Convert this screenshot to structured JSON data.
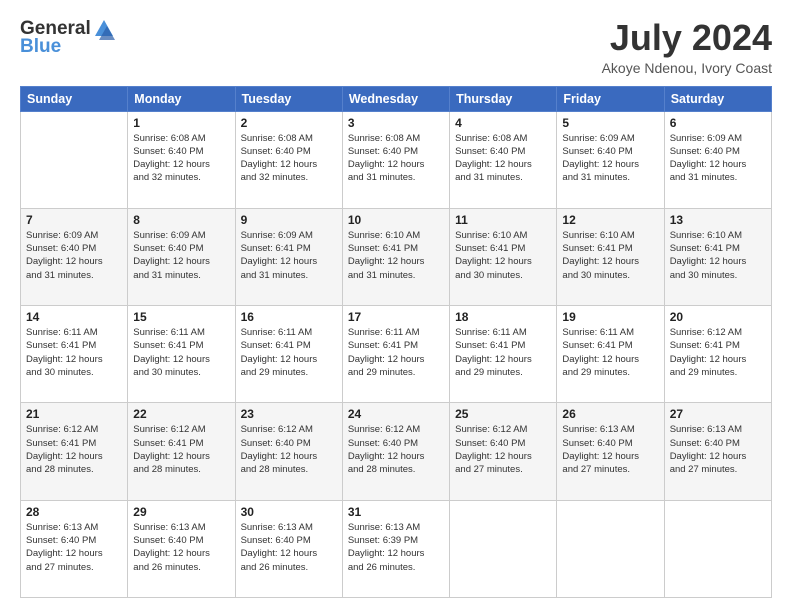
{
  "logo": {
    "general": "General",
    "blue": "Blue"
  },
  "header": {
    "month": "July 2024",
    "location": "Akoye Ndenou, Ivory Coast"
  },
  "weekdays": [
    "Sunday",
    "Monday",
    "Tuesday",
    "Wednesday",
    "Thursday",
    "Friday",
    "Saturday"
  ],
  "weeks": [
    [
      {
        "day": "",
        "info": ""
      },
      {
        "day": "1",
        "info": "Sunrise: 6:08 AM\nSunset: 6:40 PM\nDaylight: 12 hours\nand 32 minutes."
      },
      {
        "day": "2",
        "info": "Sunrise: 6:08 AM\nSunset: 6:40 PM\nDaylight: 12 hours\nand 32 minutes."
      },
      {
        "day": "3",
        "info": "Sunrise: 6:08 AM\nSunset: 6:40 PM\nDaylight: 12 hours\nand 31 minutes."
      },
      {
        "day": "4",
        "info": "Sunrise: 6:08 AM\nSunset: 6:40 PM\nDaylight: 12 hours\nand 31 minutes."
      },
      {
        "day": "5",
        "info": "Sunrise: 6:09 AM\nSunset: 6:40 PM\nDaylight: 12 hours\nand 31 minutes."
      },
      {
        "day": "6",
        "info": "Sunrise: 6:09 AM\nSunset: 6:40 PM\nDaylight: 12 hours\nand 31 minutes."
      }
    ],
    [
      {
        "day": "7",
        "info": "Sunrise: 6:09 AM\nSunset: 6:40 PM\nDaylight: 12 hours\nand 31 minutes."
      },
      {
        "day": "8",
        "info": "Sunrise: 6:09 AM\nSunset: 6:40 PM\nDaylight: 12 hours\nand 31 minutes."
      },
      {
        "day": "9",
        "info": "Sunrise: 6:09 AM\nSunset: 6:41 PM\nDaylight: 12 hours\nand 31 minutes."
      },
      {
        "day": "10",
        "info": "Sunrise: 6:10 AM\nSunset: 6:41 PM\nDaylight: 12 hours\nand 31 minutes."
      },
      {
        "day": "11",
        "info": "Sunrise: 6:10 AM\nSunset: 6:41 PM\nDaylight: 12 hours\nand 30 minutes."
      },
      {
        "day": "12",
        "info": "Sunrise: 6:10 AM\nSunset: 6:41 PM\nDaylight: 12 hours\nand 30 minutes."
      },
      {
        "day": "13",
        "info": "Sunrise: 6:10 AM\nSunset: 6:41 PM\nDaylight: 12 hours\nand 30 minutes."
      }
    ],
    [
      {
        "day": "14",
        "info": "Sunrise: 6:11 AM\nSunset: 6:41 PM\nDaylight: 12 hours\nand 30 minutes."
      },
      {
        "day": "15",
        "info": "Sunrise: 6:11 AM\nSunset: 6:41 PM\nDaylight: 12 hours\nand 30 minutes."
      },
      {
        "day": "16",
        "info": "Sunrise: 6:11 AM\nSunset: 6:41 PM\nDaylight: 12 hours\nand 29 minutes."
      },
      {
        "day": "17",
        "info": "Sunrise: 6:11 AM\nSunset: 6:41 PM\nDaylight: 12 hours\nand 29 minutes."
      },
      {
        "day": "18",
        "info": "Sunrise: 6:11 AM\nSunset: 6:41 PM\nDaylight: 12 hours\nand 29 minutes."
      },
      {
        "day": "19",
        "info": "Sunrise: 6:11 AM\nSunset: 6:41 PM\nDaylight: 12 hours\nand 29 minutes."
      },
      {
        "day": "20",
        "info": "Sunrise: 6:12 AM\nSunset: 6:41 PM\nDaylight: 12 hours\nand 29 minutes."
      }
    ],
    [
      {
        "day": "21",
        "info": "Sunrise: 6:12 AM\nSunset: 6:41 PM\nDaylight: 12 hours\nand 28 minutes."
      },
      {
        "day": "22",
        "info": "Sunrise: 6:12 AM\nSunset: 6:41 PM\nDaylight: 12 hours\nand 28 minutes."
      },
      {
        "day": "23",
        "info": "Sunrise: 6:12 AM\nSunset: 6:40 PM\nDaylight: 12 hours\nand 28 minutes."
      },
      {
        "day": "24",
        "info": "Sunrise: 6:12 AM\nSunset: 6:40 PM\nDaylight: 12 hours\nand 28 minutes."
      },
      {
        "day": "25",
        "info": "Sunrise: 6:12 AM\nSunset: 6:40 PM\nDaylight: 12 hours\nand 27 minutes."
      },
      {
        "day": "26",
        "info": "Sunrise: 6:13 AM\nSunset: 6:40 PM\nDaylight: 12 hours\nand 27 minutes."
      },
      {
        "day": "27",
        "info": "Sunrise: 6:13 AM\nSunset: 6:40 PM\nDaylight: 12 hours\nand 27 minutes."
      }
    ],
    [
      {
        "day": "28",
        "info": "Sunrise: 6:13 AM\nSunset: 6:40 PM\nDaylight: 12 hours\nand 27 minutes."
      },
      {
        "day": "29",
        "info": "Sunrise: 6:13 AM\nSunset: 6:40 PM\nDaylight: 12 hours\nand 26 minutes."
      },
      {
        "day": "30",
        "info": "Sunrise: 6:13 AM\nSunset: 6:40 PM\nDaylight: 12 hours\nand 26 minutes."
      },
      {
        "day": "31",
        "info": "Sunrise: 6:13 AM\nSunset: 6:39 PM\nDaylight: 12 hours\nand 26 minutes."
      },
      {
        "day": "",
        "info": ""
      },
      {
        "day": "",
        "info": ""
      },
      {
        "day": "",
        "info": ""
      }
    ]
  ]
}
